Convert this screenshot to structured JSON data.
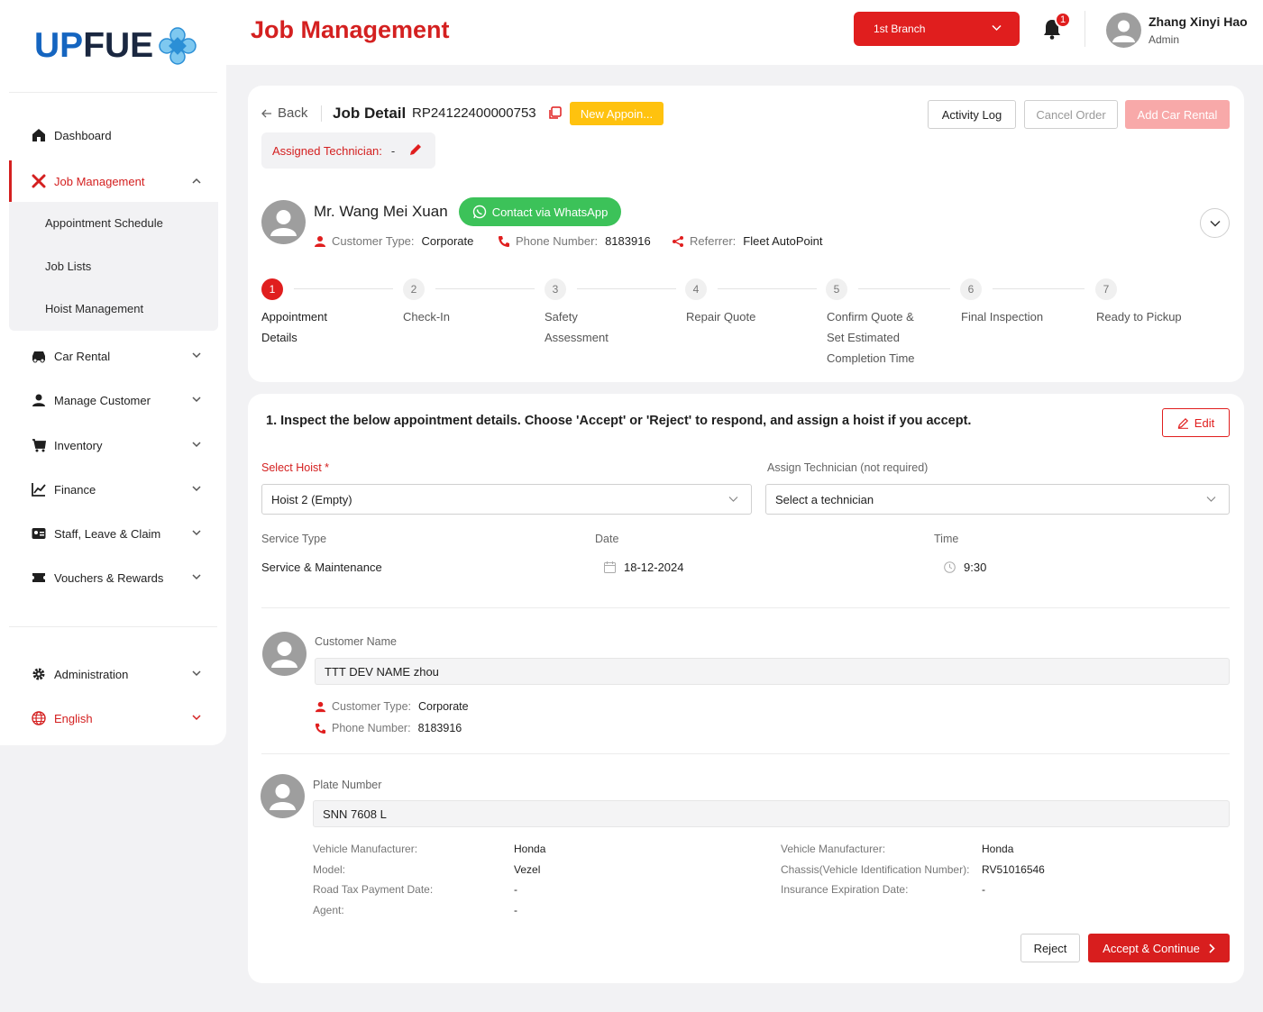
{
  "brand": {
    "logo_up": "UP",
    "logo_fue": "FUE"
  },
  "sidebar": {
    "dashboard": "Dashboard",
    "job_management": "Job Management",
    "sub_items": [
      "Appointment Schedule",
      "Job Lists",
      "Hoist Management"
    ],
    "car_rental": "Car Rental",
    "manage_customer": "Manage Customer",
    "inventory": "Inventory",
    "finance": "Finance",
    "staff": "Staff, Leave & Claim",
    "vouchers": "Vouchers & Rewards",
    "administration": "Administration",
    "language": "English"
  },
  "header": {
    "title": "Job Management",
    "branch": "1st Branch",
    "notification_count": "1",
    "user_name": "Zhang Xinyi Hao",
    "user_role": "Admin"
  },
  "job": {
    "back": "Back",
    "title": "Job Detail",
    "number": "RP24122400000753",
    "tag": "New Appoin...",
    "activity_log": "Activity Log",
    "cancel_order": "Cancel Order",
    "add_car_rental": "Add Car Rental",
    "assigned_label": "Assigned Technician:",
    "assigned_value": "-"
  },
  "customer": {
    "name": "Mr. Wang Mei Xuan",
    "whatsapp": "Contact via WhatsApp",
    "type_label": "Customer Type:",
    "type_value": "Corporate",
    "phone_label": "Phone Number:",
    "phone_value": "8183916",
    "referrer_label": "Referrer:",
    "referrer_value": "Fleet AutoPoint"
  },
  "steps": [
    {
      "num": "1",
      "label": "Appointment Details"
    },
    {
      "num": "2",
      "label": "Check-In"
    },
    {
      "num": "3",
      "label": "Safety Assessment"
    },
    {
      "num": "4",
      "label": "Repair Quote"
    },
    {
      "num": "5",
      "label": "Confirm Quote & Set Estimated Completion Time"
    },
    {
      "num": "6",
      "label": "Final Inspection"
    },
    {
      "num": "7",
      "label": "Ready to Pickup"
    }
  ],
  "details": {
    "instruction": "1. Inspect the below appointment details. Choose 'Accept' or 'Reject' to respond, and assign a hoist if you accept.",
    "edit": "Edit",
    "hoist_label": "Select Hoist *",
    "hoist_value": "Hoist 2 (Empty)",
    "tech_label": "Assign Technician (not required)",
    "tech_value": "Select a technician",
    "service_type_label": "Service Type",
    "service_type_value": "Service & Maintenance",
    "date_label": "Date",
    "date_value": "18-12-2024",
    "time_label": "Time",
    "time_value": "9:30",
    "customer_name_label": "Customer Name",
    "customer_name_value": "TTT DEV NAME zhou",
    "cust_type_label": "Customer Type:",
    "cust_type_value": "Corporate",
    "cust_phone_label": "Phone Number:",
    "cust_phone_value": "8183916",
    "plate_label": "Plate Number",
    "plate_value": "SNN 7608 L",
    "vehicle_left": [
      {
        "label": "Vehicle Manufacturer:",
        "value": "Honda"
      },
      {
        "label": "Model:",
        "value": "Vezel"
      },
      {
        "label": "Road Tax Payment Date:",
        "value": "-"
      },
      {
        "label": "Agent:",
        "value": "-"
      }
    ],
    "vehicle_right": [
      {
        "label": "Vehicle Manufacturer:",
        "value": "Honda"
      },
      {
        "label": "Chassis(Vehicle Identification Number):",
        "value": "RV51016546"
      },
      {
        "label": "Insurance Expiration Date:",
        "value": "-"
      }
    ],
    "reject": "Reject",
    "accept": "Accept & Continue"
  },
  "colors": {
    "accent": "#e01e1e",
    "whatsapp": "#3cc259",
    "tag": "#ffc20e",
    "brand_blue": "#1565c0"
  }
}
